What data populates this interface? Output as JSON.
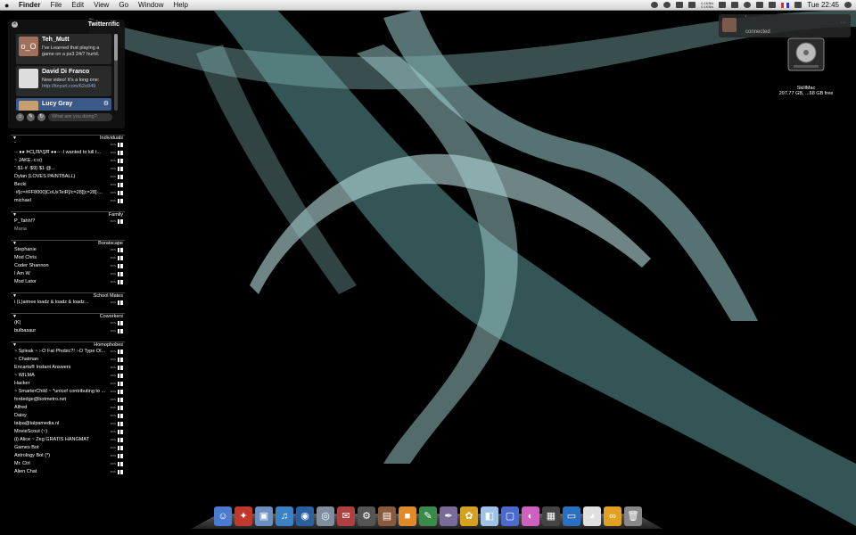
{
  "menubar": {
    "apple": "",
    "items": [
      "Finder",
      "File",
      "Edit",
      "View",
      "Go",
      "Window",
      "Help"
    ],
    "network": {
      "up": "0.1KB/s",
      "down": "0.1KB/s"
    },
    "clock": "Tue 22:45"
  },
  "twitterrific": {
    "title": "Twitterrific",
    "close_icon": "✕",
    "tweets": [
      {
        "name": "Teh_Mutt",
        "avatar_text": "o_O",
        "text": "I've Learned that playing a game on a ps3 24/7 hurtd.",
        "link": ""
      },
      {
        "name": "David Di Franco",
        "avatar_text": "",
        "text": "New video! It's a long one:",
        "link": "http://tinyurl.com/62o949"
      },
      {
        "name": "Lucy Gray",
        "avatar_text": "",
        "text": "",
        "link": ""
      }
    ],
    "input_placeholder": "What are you doing?"
  },
  "buddy_list": {
    "groups": [
      {
        "name": "Individuals",
        "buddies": [
          {
            "name": "˚",
            "status": "M3N",
            "dim": false
          },
          {
            "name": "·- ●● ÞĈĻĦɅŞĦ ●●·- ·I wanted to kill t...",
            "status": "M3N",
            "dim": false
          },
          {
            "name": "~                                   JAKE.·c:o)",
            "status": "M3N",
            "dim": false
          },
          {
            "name": "˚·$1·#                           ·$9}·$1·@...",
            "status": "M3N",
            "dim": false
          },
          {
            "name": "Dylan (LOVES PAINTBALL)",
            "status": "M3N",
            "dim": false
          },
          {
            "name": "Becki",
            "status": "M3N",
            "dim": false
          },
          {
            "name": "·#[c=#FF8000]CoUxTeiR[/c=28][c=28]·...",
            "status": "M3N",
            "dim": false
          },
          {
            "name": "michael",
            "status": "M3N",
            "dim": false
          }
        ]
      },
      {
        "name": "Family",
        "buddies": [
          {
            "name": "P_Tahh!?",
            "status": "M3N",
            "dim": false
          },
          {
            "name": "Maria",
            "status": "",
            "dim": true
          }
        ]
      },
      {
        "name": "Boratscape",
        "buddies": [
          {
            "name": "Stephanie",
            "status": "M3N",
            "dim": false
          },
          {
            "name": "Mod Chris",
            "status": "M3N",
            "dim": false
          },
          {
            "name": "Coder Shannon",
            "status": "M3N",
            "dim": false
          },
          {
            "name": "I Am W",
            "status": "M3N",
            "dim": false
          },
          {
            "name": "Mod Lator",
            "status": "M3N",
            "dim": false
          }
        ]
      },
      {
        "name": "School Mates",
        "buddies": [
          {
            "name": "i (L)aimee loadz & loadz & loadz...",
            "status": "M3N",
            "dim": false
          }
        ]
      },
      {
        "name": "Coworkers",
        "buddies": [
          {
            "name": "(K)",
            "status": "M3N",
            "dim": false
          },
          {
            "name": "bulbasaur",
            "status": "M3N",
            "dim": false
          }
        ]
      },
      {
        "name": "Homophobes",
        "buddies": [
          {
            "name": "~ Spleak ~ :-O Fat Phobic?! :-O Type Ol...",
            "status": "M3N",
            "dim": false
          },
          {
            "name": "~ Chatman",
            "status": "M3N",
            "dim": false
          },
          {
            "name": "Encarta® Instant Answers",
            "status": "M3N",
            "dim": false
          },
          {
            "name": "~ WILMA",
            "status": "M3N",
            "dim": false
          },
          {
            "name": "Hacker",
            "status": "M3N",
            "dim": false
          },
          {
            "name": "~ SmarterChild ~ *unicef contributing to ...",
            "status": "M3N",
            "dim": false
          },
          {
            "name": "fordedge@botmetro.net",
            "status": "M3N",
            "dim": false
          },
          {
            "name": "Alfred",
            "status": "M3N",
            "dim": false
          },
          {
            "name": "Daisy",
            "status": "M3N",
            "dim": false
          },
          {
            "name": "talpa@talpamedia.nl",
            "status": "M3N",
            "dim": false
          },
          {
            "name": "MovieScout (~)",
            "status": "M3N",
            "dim": false
          },
          {
            "name": "(i) Alice ~ Zeg GRATIS HANGMAT",
            "status": "M3N",
            "dim": false
          },
          {
            "name": "Games Bot",
            "status": "M3N",
            "dim": false
          },
          {
            "name": "Astrology Bot (*)",
            "status": "M3N",
            "dim": false
          },
          {
            "name": "Mr. Ctrl",
            "status": "M3N",
            "dim": false
          },
          {
            "name": "Alien Chat",
            "status": "M3N",
            "dim": false
          }
        ]
      }
    ]
  },
  "notification": {
    "name": "'",
    "status": "connected",
    "dots": "···"
  },
  "disk": {
    "name": "SkillMac",
    "info": "297.77 GB, ...68 GB free"
  },
  "dock": {
    "icons": [
      {
        "name": "finder-icon",
        "glyph": "☺",
        "color": "#4a7bd0"
      },
      {
        "name": "fire-icon",
        "glyph": "✦",
        "color": "#c0392b"
      },
      {
        "name": "preview-icon",
        "glyph": "▣",
        "color": "#6a8fc0"
      },
      {
        "name": "itunes-icon",
        "glyph": "♫",
        "color": "#3b82c4"
      },
      {
        "name": "network-icon",
        "glyph": "◉",
        "color": "#2a5fa0"
      },
      {
        "name": "safari-icon",
        "glyph": "◎",
        "color": "#7f8fa0"
      },
      {
        "name": "stamp-icon",
        "glyph": "✉",
        "color": "#b04040"
      },
      {
        "name": "system-icon",
        "glyph": "⚙",
        "color": "#555"
      },
      {
        "name": "album-icon",
        "glyph": "▤",
        "color": "#8a5a3a"
      },
      {
        "name": "box-icon",
        "glyph": "■",
        "color": "#e08a2a"
      },
      {
        "name": "text-icon",
        "glyph": "✎",
        "color": "#3a8a4a"
      },
      {
        "name": "pen-icon",
        "glyph": "✒",
        "color": "#7a6a9a"
      },
      {
        "name": "photo-icon",
        "glyph": "✿",
        "color": "#d4a020"
      },
      {
        "name": "color-icon",
        "glyph": "◧",
        "color": "#9fc2e8"
      },
      {
        "name": "frame-icon",
        "glyph": "▢",
        "color": "#4a6ad0"
      },
      {
        "name": "calendar-icon",
        "glyph": "◐",
        "color": "#d060c0"
      },
      {
        "name": "clapper-icon",
        "glyph": "▦",
        "color": "#444"
      },
      {
        "name": "monitor-icon",
        "glyph": "▭",
        "color": "#2a70c0"
      },
      {
        "name": "helmet-icon",
        "glyph": "◕",
        "color": "#e0e0e0"
      },
      {
        "name": "chain-icon",
        "glyph": "∞",
        "color": "#e0a020"
      },
      {
        "name": "trash-icon",
        "glyph": "🗑",
        "color": "#888"
      }
    ]
  }
}
